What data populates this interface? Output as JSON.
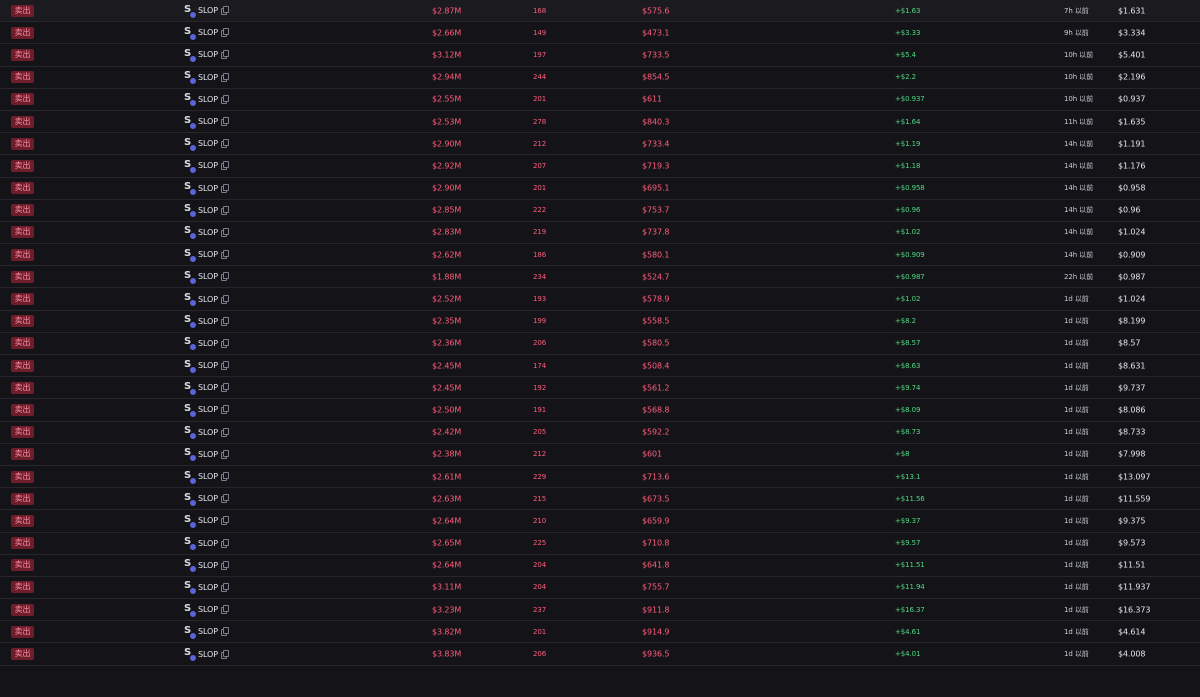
{
  "table": {
    "rows": [
      {
        "type": "卖出",
        "token": "SLOP",
        "mcap": "$2.87M",
        "holders": "168",
        "value": "$575.6",
        "pnl": "+$1.63",
        "age": "7h 以前",
        "price": "$1.631"
      },
      {
        "type": "卖出",
        "token": "SLOP",
        "mcap": "$2.66M",
        "holders": "149",
        "value": "$473.1",
        "pnl": "+$3.33",
        "age": "9h 以前",
        "price": "$3.334"
      },
      {
        "type": "卖出",
        "token": "SLOP",
        "mcap": "$3.12M",
        "holders": "197",
        "value": "$733.5",
        "pnl": "+$5.4",
        "age": "10h 以前",
        "price": "$5.401"
      },
      {
        "type": "卖出",
        "token": "SLOP",
        "mcap": "$2.94M",
        "holders": "244",
        "value": "$854.5",
        "pnl": "+$2.2",
        "age": "10h 以前",
        "price": "$2.196"
      },
      {
        "type": "卖出",
        "token": "SLOP",
        "mcap": "$2.55M",
        "holders": "201",
        "value": "$611",
        "pnl": "+$0.937",
        "age": "10h 以前",
        "price": "$0.937"
      },
      {
        "type": "卖出",
        "token": "SLOP",
        "mcap": "$2.53M",
        "holders": "278",
        "value": "$840.3",
        "pnl": "+$1.64",
        "age": "11h 以前",
        "price": "$1.635"
      },
      {
        "type": "卖出",
        "token": "SLOP",
        "mcap": "$2.90M",
        "holders": "212",
        "value": "$733.4",
        "pnl": "+$1.19",
        "age": "14h 以前",
        "price": "$1.191"
      },
      {
        "type": "卖出",
        "token": "SLOP",
        "mcap": "$2.92M",
        "holders": "207",
        "value": "$719.3",
        "pnl": "+$1.18",
        "age": "14h 以前",
        "price": "$1.176"
      },
      {
        "type": "卖出",
        "token": "SLOP",
        "mcap": "$2.90M",
        "holders": "201",
        "value": "$695.1",
        "pnl": "+$0.958",
        "age": "14h 以前",
        "price": "$0.958"
      },
      {
        "type": "卖出",
        "token": "SLOP",
        "mcap": "$2.85M",
        "holders": "222",
        "value": "$753.7",
        "pnl": "+$0.96",
        "age": "14h 以前",
        "price": "$0.96"
      },
      {
        "type": "卖出",
        "token": "SLOP",
        "mcap": "$2.83M",
        "holders": "219",
        "value": "$737.8",
        "pnl": "+$1.02",
        "age": "14h 以前",
        "price": "$1.024"
      },
      {
        "type": "卖出",
        "token": "SLOP",
        "mcap": "$2.62M",
        "holders": "186",
        "value": "$580.1",
        "pnl": "+$0.909",
        "age": "14h 以前",
        "price": "$0.909"
      },
      {
        "type": "卖出",
        "token": "SLOP",
        "mcap": "$1.88M",
        "holders": "234",
        "value": "$524.7",
        "pnl": "+$0.987",
        "age": "22h 以前",
        "price": "$0.987"
      },
      {
        "type": "卖出",
        "token": "SLOP",
        "mcap": "$2.52M",
        "holders": "193",
        "value": "$578.9",
        "pnl": "+$1.02",
        "age": "1d 以前",
        "price": "$1.024"
      },
      {
        "type": "卖出",
        "token": "SLOP",
        "mcap": "$2.35M",
        "holders": "199",
        "value": "$558.5",
        "pnl": "+$8.2",
        "age": "1d 以前",
        "price": "$8.199"
      },
      {
        "type": "卖出",
        "token": "SLOP",
        "mcap": "$2.36M",
        "holders": "206",
        "value": "$580.5",
        "pnl": "+$8.57",
        "age": "1d 以前",
        "price": "$8.57"
      },
      {
        "type": "卖出",
        "token": "SLOP",
        "mcap": "$2.45M",
        "holders": "174",
        "value": "$508.4",
        "pnl": "+$8.63",
        "age": "1d 以前",
        "price": "$8.631"
      },
      {
        "type": "卖出",
        "token": "SLOP",
        "mcap": "$2.45M",
        "holders": "192",
        "value": "$561.2",
        "pnl": "+$9.74",
        "age": "1d 以前",
        "price": "$9.737"
      },
      {
        "type": "卖出",
        "token": "SLOP",
        "mcap": "$2.50M",
        "holders": "191",
        "value": "$568.8",
        "pnl": "+$8.09",
        "age": "1d 以前",
        "price": "$8.086"
      },
      {
        "type": "卖出",
        "token": "SLOP",
        "mcap": "$2.42M",
        "holders": "205",
        "value": "$592.2",
        "pnl": "+$8.73",
        "age": "1d 以前",
        "price": "$8.733"
      },
      {
        "type": "卖出",
        "token": "SLOP",
        "mcap": "$2.38M",
        "holders": "212",
        "value": "$601",
        "pnl": "+$8",
        "age": "1d 以前",
        "price": "$7.998"
      },
      {
        "type": "卖出",
        "token": "SLOP",
        "mcap": "$2.61M",
        "holders": "229",
        "value": "$713.6",
        "pnl": "+$13.1",
        "age": "1d 以前",
        "price": "$13.097"
      },
      {
        "type": "卖出",
        "token": "SLOP",
        "mcap": "$2.63M",
        "holders": "215",
        "value": "$673.5",
        "pnl": "+$11.56",
        "age": "1d 以前",
        "price": "$11.559"
      },
      {
        "type": "卖出",
        "token": "SLOP",
        "mcap": "$2.64M",
        "holders": "210",
        "value": "$659.9",
        "pnl": "+$9.37",
        "age": "1d 以前",
        "price": "$9.375"
      },
      {
        "type": "卖出",
        "token": "SLOP",
        "mcap": "$2.65M",
        "holders": "225",
        "value": "$710.8",
        "pnl": "+$9.57",
        "age": "1d 以前",
        "price": "$9.573"
      },
      {
        "type": "卖出",
        "token": "SLOP",
        "mcap": "$2.64M",
        "holders": "204",
        "value": "$641.8",
        "pnl": "+$11.51",
        "age": "1d 以前",
        "price": "$11.51"
      },
      {
        "type": "卖出",
        "token": "SLOP",
        "mcap": "$3.11M",
        "holders": "204",
        "value": "$755.7",
        "pnl": "+$11.94",
        "age": "1d 以前",
        "price": "$11.937"
      },
      {
        "type": "卖出",
        "token": "SLOP",
        "mcap": "$3.23M",
        "holders": "237",
        "value": "$911.8",
        "pnl": "+$16.37",
        "age": "1d 以前",
        "price": "$16.373"
      },
      {
        "type": "卖出",
        "token": "SLOP",
        "mcap": "$3.82M",
        "holders": "201",
        "value": "$914.9",
        "pnl": "+$4.61",
        "age": "1d 以前",
        "price": "$4.614"
      },
      {
        "type": "卖出",
        "token": "SLOP",
        "mcap": "$3.83M",
        "holders": "206",
        "value": "$936.5",
        "pnl": "+$4.01",
        "age": "1d 以前",
        "price": "$4.008"
      }
    ]
  },
  "colors": {
    "background": "#141418",
    "sell_badge_bg": "#6e1d2b",
    "sell_text": "#ff5c7c",
    "pnl_positive": "#4fd882"
  },
  "icons": {
    "token_logo": "token-logo-icon",
    "chain_badge": "chain-badge-icon",
    "copy": "copy-icon"
  }
}
